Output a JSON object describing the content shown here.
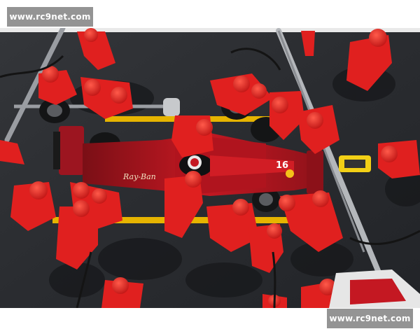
{
  "watermarks": {
    "top_left": "www.rc9net.com",
    "bottom_right": "www.rc9net.com"
  },
  "photo": {
    "car_number": "16",
    "car_text_front": "Ray-Ban",
    "car_sponsor_side": "Ray-Ban",
    "colors": {
      "asphalt": "#2a2c30",
      "ferrari_red": "#c8141a",
      "crew_red": "#e0201f",
      "pit_line_yellow": "#e6b400",
      "white_line": "#e9e9e9",
      "shell_yellow": "#f4c21a",
      "equipment_grey": "#9a9da2"
    }
  }
}
